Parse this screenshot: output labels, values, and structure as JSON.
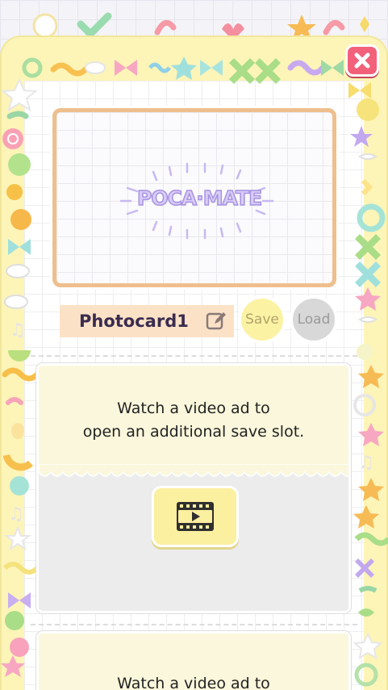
{
  "window": {
    "close_icon": "close-icon"
  },
  "photocard": {
    "logo_text": "POCA·MATE"
  },
  "slot": {
    "name": "Photocard1",
    "edit_icon": "pencil-icon",
    "save_label": "Save",
    "load_label": "Load"
  },
  "ad_slots": [
    {
      "line1": "Watch a video ad to",
      "line2": "open an additional save slot.",
      "button_icon": "film-icon"
    },
    {
      "line1": "Watch a video ad to",
      "line2": ""
    }
  ],
  "colors": {
    "frame": "#fdf4b8",
    "close": "#f2607a",
    "card_border": "#eebf8d",
    "save": "#fcf2a4",
    "load": "#d8d8d8"
  }
}
